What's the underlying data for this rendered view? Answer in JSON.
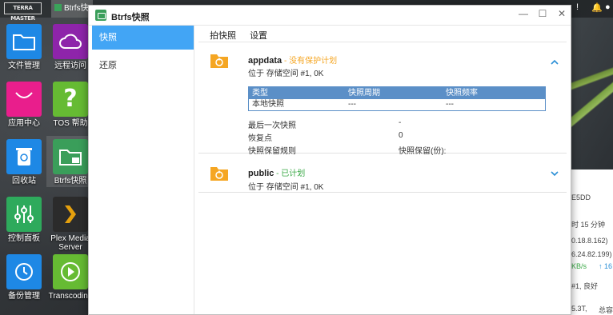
{
  "taskbar": {
    "brand_logo": "TERRA MASTER",
    "active_task": "Btrfs快"
  },
  "desktop": {
    "icons": [
      {
        "label": "文件管理",
        "icon": "folder-icon",
        "color": "#1e88e5"
      },
      {
        "label": "远程访问",
        "icon": "cloud-icon",
        "color": "#8e24aa"
      },
      {
        "label": "应用中心",
        "icon": "store-bag-icon",
        "color": "#e91e8c"
      },
      {
        "label": "TOS 帮助",
        "icon": "question-icon",
        "color": "#66bb33"
      },
      {
        "label": "回收站",
        "icon": "recycle-bin-icon",
        "color": "#1e88e5"
      },
      {
        "label": "Btrfs快照",
        "icon": "snapshot-folder-icon",
        "color": "#3a9e5a"
      },
      {
        "label": "控制面板",
        "icon": "sliders-icon",
        "color": "#2eaa5c"
      },
      {
        "label": "Plex Media Server",
        "icon": "plex-chevron-icon",
        "color": "#2b2b2b"
      },
      {
        "label": "备份管理",
        "icon": "clock-backup-icon",
        "color": "#1e88e5"
      },
      {
        "label": "Transcoding",
        "icon": "play-icon",
        "color": "#66bb33"
      }
    ]
  },
  "right_panel": {
    "lines": [
      "E5DD",
      "时 15 分钟",
      "0.18.8.162)",
      "6.24.82.199)",
      "KB/s",
      "↑ 16",
      "#1, 良好",
      "5.3T,",
      "总容"
    ]
  },
  "window": {
    "title": "Btrfs快照",
    "controls": {
      "minimize": "—",
      "maximize": "☐",
      "close": "✕"
    }
  },
  "sidebar": {
    "items": [
      {
        "label": "快照",
        "active": true
      },
      {
        "label": "还原",
        "active": false
      }
    ]
  },
  "tabs": [
    {
      "label": "拍快照"
    },
    {
      "label": "设置"
    }
  ],
  "volumes": [
    {
      "name": "appdata",
      "separator": " - ",
      "status": "没有保护计划",
      "status_type": "warning",
      "location": "位于 存储空间 #1, 0K",
      "expanded": true,
      "table": {
        "headers": [
          "类型",
          "快照周期",
          "快照频率"
        ],
        "rows": [
          [
            "本地快照",
            "---",
            "---"
          ]
        ]
      },
      "details": [
        {
          "label": "最后一次快照",
          "value": "-"
        },
        {
          "label": "恢复点",
          "value": "0"
        },
        {
          "label": "快照保留规则",
          "value": "快照保留(份):"
        }
      ]
    },
    {
      "name": "public",
      "separator": " - ",
      "status": "已计划",
      "status_type": "ok",
      "location": "位于 存储空间 #1, 0K",
      "expanded": false
    }
  ],
  "colors": {
    "accent": "#42a5f5",
    "table_header": "#5b8fc7",
    "warning": "#f5a623",
    "ok": "#39a845",
    "folder": "#f5a623"
  }
}
